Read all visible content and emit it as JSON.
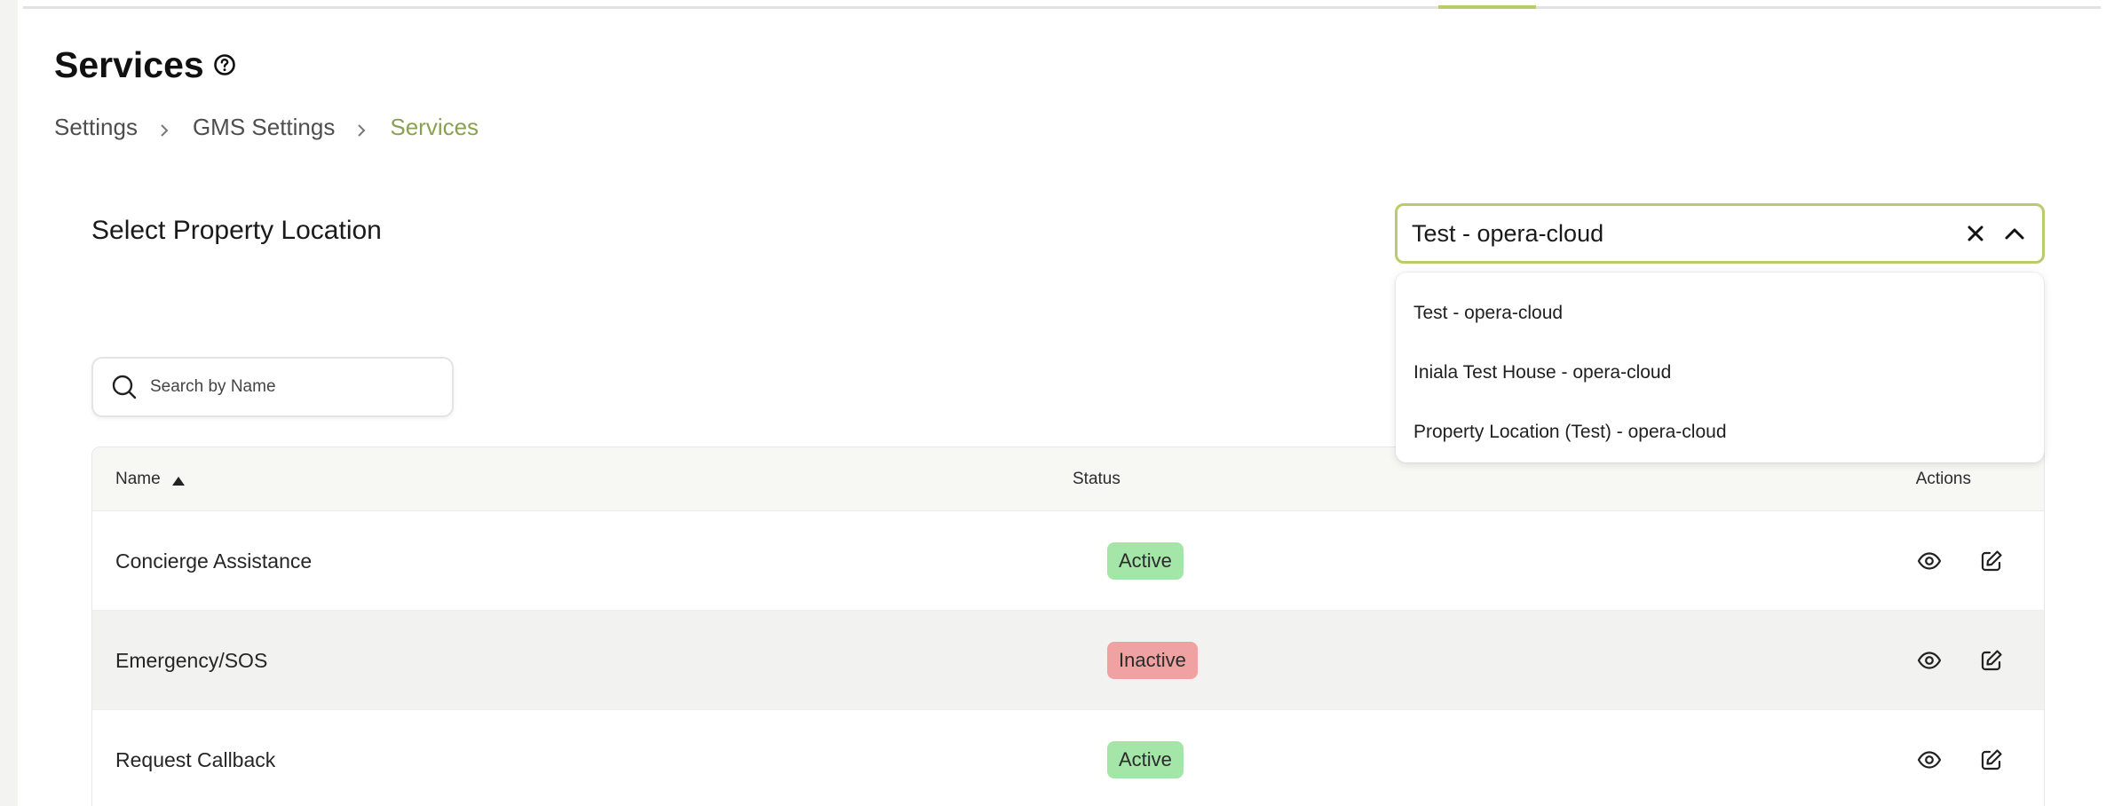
{
  "page": {
    "title": "Services",
    "help_icon": "question-circle-icon"
  },
  "breadcrumb": [
    {
      "label": "Settings"
    },
    {
      "label": "GMS Settings"
    },
    {
      "label": "Services"
    }
  ],
  "property_select": {
    "label": "Select Property Location",
    "value": "Test - opera-cloud",
    "clear_icon": "close-icon",
    "toggle_icon": "chevron-up-icon",
    "options": [
      "Test - opera-cloud",
      "Iniala Test House - opera-cloud",
      "Property Location (Test) - opera-cloud"
    ]
  },
  "search": {
    "placeholder": "Search by Name",
    "value": ""
  },
  "table": {
    "columns": {
      "name": "Name",
      "status": "Status",
      "actions": "Actions"
    },
    "sort": {
      "column": "Name",
      "direction": "ascending"
    },
    "rows": [
      {
        "name": "Concierge Assistance",
        "status": "Active"
      },
      {
        "name": "Emergency/SOS",
        "status": "Inactive"
      },
      {
        "name": "Request Callback",
        "status": "Active"
      }
    ]
  },
  "colors": {
    "accent": "#b8cc6a",
    "breadcrumb_current": "#8aa152",
    "active_badge": "#a3e6a7",
    "inactive_badge": "#f0a1a1"
  }
}
